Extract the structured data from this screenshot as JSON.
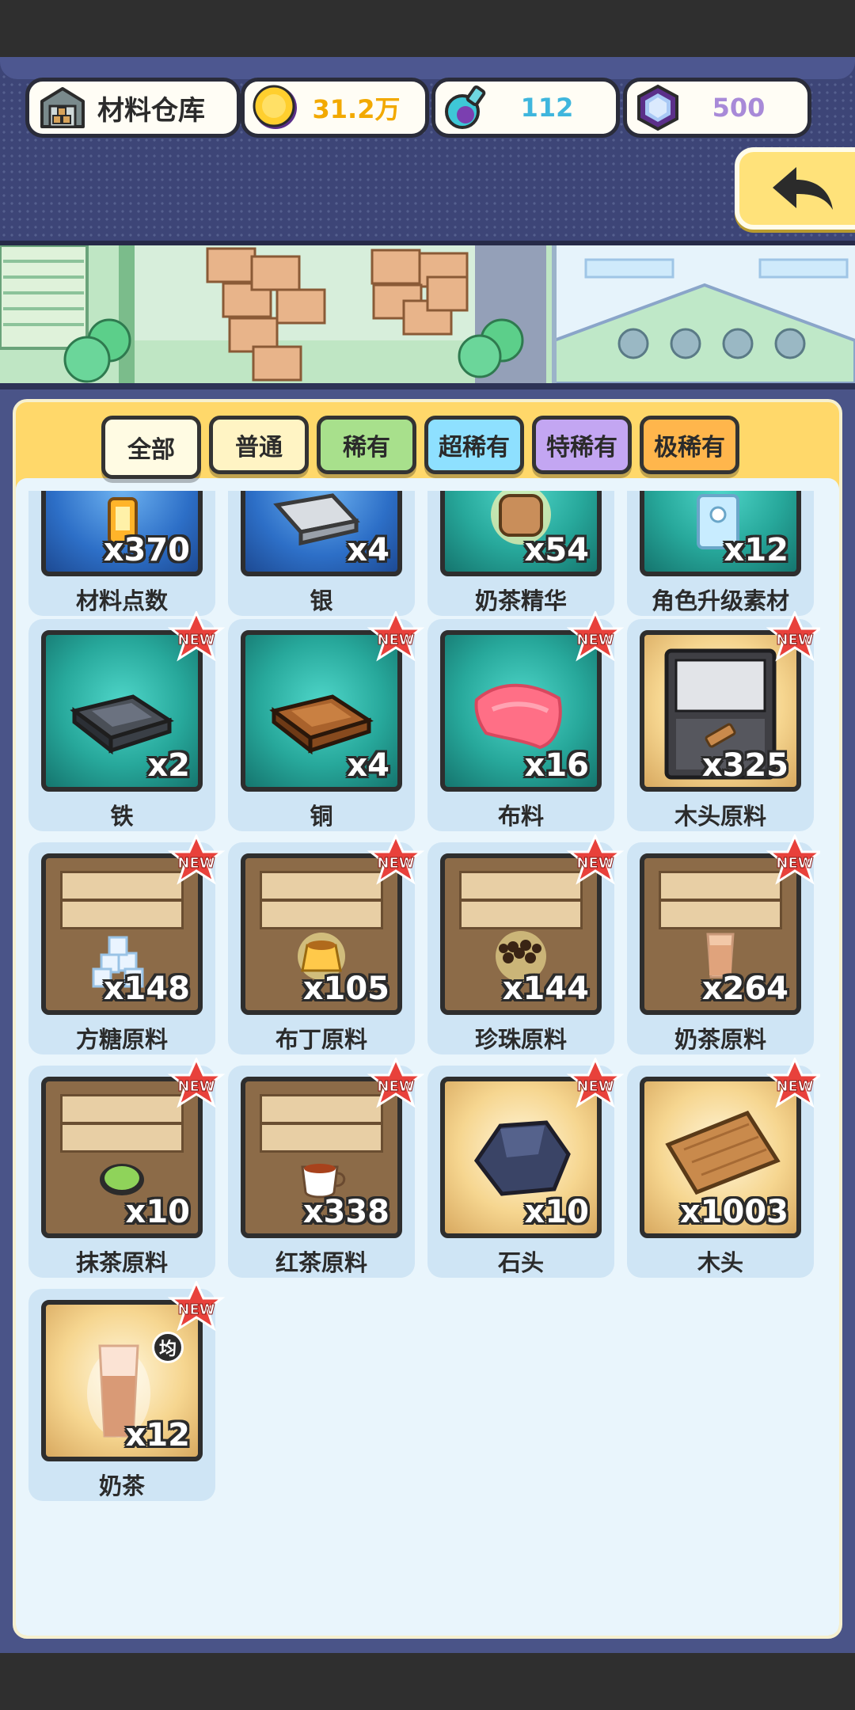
{
  "header": {
    "warehouse_label": "材料仓库",
    "coins": "31.2万",
    "potions": "112",
    "gems": "500"
  },
  "colors": {
    "coin_text": "#f2a900",
    "potion_text": "#3fb6dd",
    "gem_text": "#a88ad8",
    "tab_common": "#fff4c4",
    "tab_rare": "#a8e08c",
    "tab_super_rare": "#8ee0ff",
    "tab_special_rare": "#c3a6f2",
    "tab_ultra_rare": "#ffb64c"
  },
  "tabs": [
    {
      "label": "全部",
      "active": true
    },
    {
      "label": "普通",
      "active": false
    },
    {
      "label": "稀有",
      "active": false
    },
    {
      "label": "超稀有",
      "active": false
    },
    {
      "label": "特稀有",
      "active": false
    },
    {
      "label": "极稀有",
      "active": false
    }
  ],
  "items": [
    {
      "name": "材料点数",
      "qty": "x370",
      "icon": "material-points-icon",
      "new": false
    },
    {
      "name": "银",
      "qty": "x4",
      "icon": "silver-ingot-icon",
      "new": false
    },
    {
      "name": "奶茶精华",
      "qty": "x54",
      "icon": "milk-tea-essence-icon",
      "new": false
    },
    {
      "name": "角色升级素材",
      "qty": "x12",
      "icon": "character-upgrade-card-icon",
      "new": false
    },
    {
      "name": "铁",
      "qty": "x2",
      "icon": "iron-ingot-icon",
      "new": true
    },
    {
      "name": "铜",
      "qty": "x4",
      "icon": "copper-ingot-icon",
      "new": true
    },
    {
      "name": "布料",
      "qty": "x16",
      "icon": "cloth-icon",
      "new": true
    },
    {
      "name": "木头原料",
      "qty": "x325",
      "icon": "wood-crate-icon",
      "new": true
    },
    {
      "name": "方糖原料",
      "qty": "x148",
      "icon": "sugar-cube-box-icon",
      "new": true
    },
    {
      "name": "布丁原料",
      "qty": "x105",
      "icon": "pudding-box-icon",
      "new": true
    },
    {
      "name": "珍珠原料",
      "qty": "x144",
      "icon": "pearl-box-icon",
      "new": true
    },
    {
      "name": "奶茶原料",
      "qty": "x264",
      "icon": "milk-tea-box-icon",
      "new": true
    },
    {
      "name": "抹茶原料",
      "qty": "x10",
      "icon": "matcha-box-icon",
      "new": true
    },
    {
      "name": "红茶原料",
      "qty": "x338",
      "icon": "black-tea-box-icon",
      "new": true
    },
    {
      "name": "石头",
      "qty": "x10",
      "icon": "stone-icon",
      "new": true
    },
    {
      "name": "木头",
      "qty": "x1003",
      "icon": "wood-plank-icon",
      "new": true
    },
    {
      "name": "奶茶",
      "qty": "x12",
      "icon": "milk-tea-glass-icon",
      "new": true,
      "tag": "均"
    }
  ],
  "badge_text": "NEW"
}
